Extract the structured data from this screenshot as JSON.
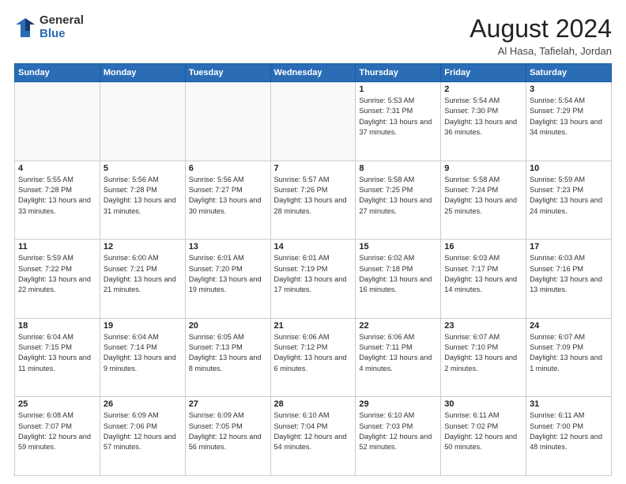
{
  "logo": {
    "general": "General",
    "blue": "Blue"
  },
  "header": {
    "month": "August 2024",
    "location": "Al Hasa, Tafielah, Jordan"
  },
  "weekdays": [
    "Sunday",
    "Monday",
    "Tuesday",
    "Wednesday",
    "Thursday",
    "Friday",
    "Saturday"
  ],
  "weeks": [
    [
      {
        "day": "",
        "empty": true
      },
      {
        "day": "",
        "empty": true
      },
      {
        "day": "",
        "empty": true
      },
      {
        "day": "",
        "empty": true
      },
      {
        "day": "1",
        "sunrise": "5:53 AM",
        "sunset": "7:31 PM",
        "daylight": "13 hours and 37 minutes."
      },
      {
        "day": "2",
        "sunrise": "5:54 AM",
        "sunset": "7:30 PM",
        "daylight": "13 hours and 36 minutes."
      },
      {
        "day": "3",
        "sunrise": "5:54 AM",
        "sunset": "7:29 PM",
        "daylight": "13 hours and 34 minutes."
      }
    ],
    [
      {
        "day": "4",
        "sunrise": "5:55 AM",
        "sunset": "7:28 PM",
        "daylight": "13 hours and 33 minutes."
      },
      {
        "day": "5",
        "sunrise": "5:56 AM",
        "sunset": "7:28 PM",
        "daylight": "13 hours and 31 minutes."
      },
      {
        "day": "6",
        "sunrise": "5:56 AM",
        "sunset": "7:27 PM",
        "daylight": "13 hours and 30 minutes."
      },
      {
        "day": "7",
        "sunrise": "5:57 AM",
        "sunset": "7:26 PM",
        "daylight": "13 hours and 28 minutes."
      },
      {
        "day": "8",
        "sunrise": "5:58 AM",
        "sunset": "7:25 PM",
        "daylight": "13 hours and 27 minutes."
      },
      {
        "day": "9",
        "sunrise": "5:58 AM",
        "sunset": "7:24 PM",
        "daylight": "13 hours and 25 minutes."
      },
      {
        "day": "10",
        "sunrise": "5:59 AM",
        "sunset": "7:23 PM",
        "daylight": "13 hours and 24 minutes."
      }
    ],
    [
      {
        "day": "11",
        "sunrise": "5:59 AM",
        "sunset": "7:22 PM",
        "daylight": "13 hours and 22 minutes."
      },
      {
        "day": "12",
        "sunrise": "6:00 AM",
        "sunset": "7:21 PM",
        "daylight": "13 hours and 21 minutes."
      },
      {
        "day": "13",
        "sunrise": "6:01 AM",
        "sunset": "7:20 PM",
        "daylight": "13 hours and 19 minutes."
      },
      {
        "day": "14",
        "sunrise": "6:01 AM",
        "sunset": "7:19 PM",
        "daylight": "13 hours and 17 minutes."
      },
      {
        "day": "15",
        "sunrise": "6:02 AM",
        "sunset": "7:18 PM",
        "daylight": "13 hours and 16 minutes."
      },
      {
        "day": "16",
        "sunrise": "6:03 AM",
        "sunset": "7:17 PM",
        "daylight": "13 hours and 14 minutes."
      },
      {
        "day": "17",
        "sunrise": "6:03 AM",
        "sunset": "7:16 PM",
        "daylight": "13 hours and 13 minutes."
      }
    ],
    [
      {
        "day": "18",
        "sunrise": "6:04 AM",
        "sunset": "7:15 PM",
        "daylight": "13 hours and 11 minutes."
      },
      {
        "day": "19",
        "sunrise": "6:04 AM",
        "sunset": "7:14 PM",
        "daylight": "13 hours and 9 minutes."
      },
      {
        "day": "20",
        "sunrise": "6:05 AM",
        "sunset": "7:13 PM",
        "daylight": "13 hours and 8 minutes."
      },
      {
        "day": "21",
        "sunrise": "6:06 AM",
        "sunset": "7:12 PM",
        "daylight": "13 hours and 6 minutes."
      },
      {
        "day": "22",
        "sunrise": "6:06 AM",
        "sunset": "7:11 PM",
        "daylight": "13 hours and 4 minutes."
      },
      {
        "day": "23",
        "sunrise": "6:07 AM",
        "sunset": "7:10 PM",
        "daylight": "13 hours and 2 minutes."
      },
      {
        "day": "24",
        "sunrise": "6:07 AM",
        "sunset": "7:09 PM",
        "daylight": "13 hours and 1 minute."
      }
    ],
    [
      {
        "day": "25",
        "sunrise": "6:08 AM",
        "sunset": "7:07 PM",
        "daylight": "12 hours and 59 minutes."
      },
      {
        "day": "26",
        "sunrise": "6:09 AM",
        "sunset": "7:06 PM",
        "daylight": "12 hours and 57 minutes."
      },
      {
        "day": "27",
        "sunrise": "6:09 AM",
        "sunset": "7:05 PM",
        "daylight": "12 hours and 56 minutes."
      },
      {
        "day": "28",
        "sunrise": "6:10 AM",
        "sunset": "7:04 PM",
        "daylight": "12 hours and 54 minutes."
      },
      {
        "day": "29",
        "sunrise": "6:10 AM",
        "sunset": "7:03 PM",
        "daylight": "12 hours and 52 minutes."
      },
      {
        "day": "30",
        "sunrise": "6:11 AM",
        "sunset": "7:02 PM",
        "daylight": "12 hours and 50 minutes."
      },
      {
        "day": "31",
        "sunrise": "6:11 AM",
        "sunset": "7:00 PM",
        "daylight": "12 hours and 48 minutes."
      }
    ]
  ],
  "labels": {
    "sunrise": "Sunrise:",
    "sunset": "Sunset:",
    "daylight": "Daylight:"
  }
}
